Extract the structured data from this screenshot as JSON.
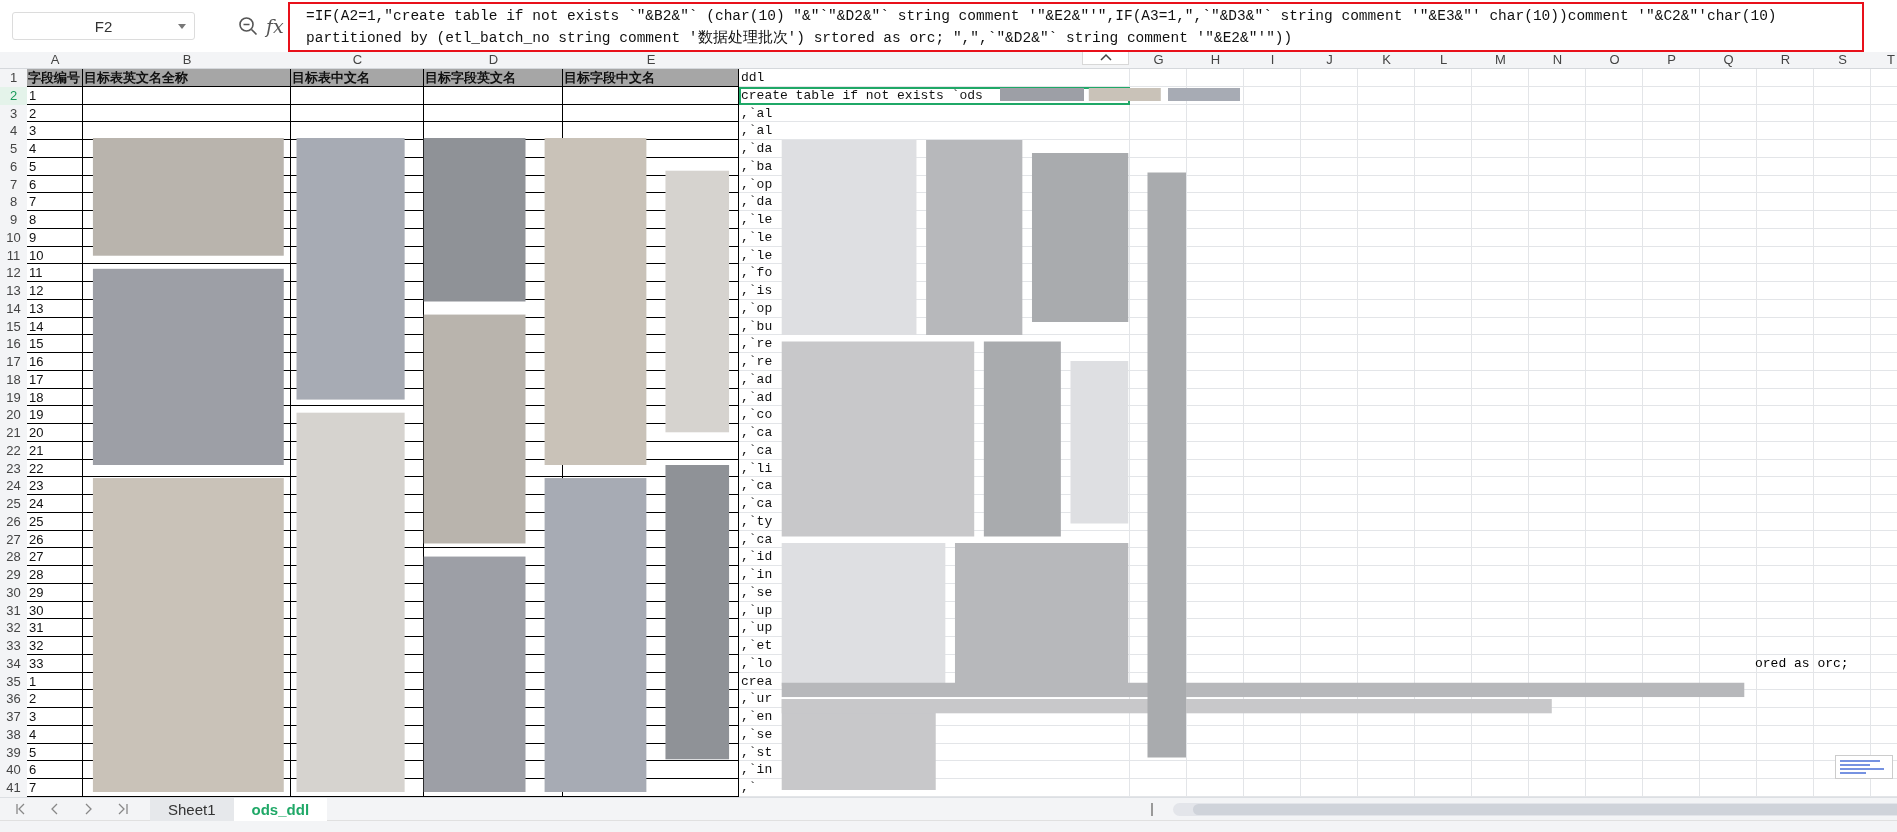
{
  "name_box": {
    "value": "F2"
  },
  "formula_bar": {
    "fx": "fx",
    "lines": [
      "=IF(A2=1,\"create table if not exists `\"&B2&\"` (char(10) \"&\"`\"&D2&\"` string comment '\"&E2&\"'\",IF(A3=1,\",`\"&D3&\"` string comment '\"&E3&\"' char(10))comment '\"&C2&\"'char(10)",
      "partitioned by (etl_batch_no string comment '数据处理批次') srtored as orc; \",\",`\"&D2&\"` string comment '\"&E2&\"'\"))"
    ]
  },
  "columns": [
    {
      "letter": "A"
    },
    {
      "letter": "B"
    },
    {
      "letter": "C"
    },
    {
      "letter": "D"
    },
    {
      "letter": "E"
    },
    {},
    {
      "letter": "G"
    },
    {
      "letter": "H"
    },
    {
      "letter": "I"
    },
    {
      "letter": "J"
    },
    {
      "letter": "K"
    },
    {
      "letter": "L"
    },
    {
      "letter": "M"
    },
    {
      "letter": "N"
    },
    {
      "letter": "O"
    },
    {
      "letter": "P"
    },
    {
      "letter": "Q"
    },
    {
      "letter": "R"
    },
    {
      "letter": "S"
    },
    {
      "letter": "T"
    }
  ],
  "header_row": {
    "num": "1",
    "cells": [
      "字段编号",
      "目标表英文名全称",
      "目标表中文名",
      "目标字段英文名",
      "目标字段中文名",
      "ddl"
    ]
  },
  "rows": [
    {
      "num": "2",
      "a": "1",
      "f": "create table if not exists `ods",
      "selected": true
    },
    {
      "num": "3",
      "a": "2",
      "f": ",`al",
      "selected": false
    },
    {
      "num": "4",
      "a": "3",
      "f": ",`al",
      "selected": false
    },
    {
      "num": "5",
      "a": "4",
      "f": ",`da",
      "selected": false
    },
    {
      "num": "6",
      "a": "5",
      "f": ",`ba",
      "selected": false
    },
    {
      "num": "7",
      "a": "6",
      "f": ",`op",
      "selected": false
    },
    {
      "num": "8",
      "a": "7",
      "f": ",`da",
      "selected": false
    },
    {
      "num": "9",
      "a": "8",
      "f": ",`le",
      "selected": false
    },
    {
      "num": "10",
      "a": "9",
      "f": ",`le",
      "selected": false
    },
    {
      "num": "11",
      "a": "10",
      "f": ",`le",
      "selected": false
    },
    {
      "num": "12",
      "a": "11",
      "f": ",`fo",
      "selected": false
    },
    {
      "num": "13",
      "a": "12",
      "f": ",`is",
      "selected": false
    },
    {
      "num": "14",
      "a": "13",
      "f": ",`op",
      "selected": false
    },
    {
      "num": "15",
      "a": "14",
      "f": ",`bu",
      "selected": false
    },
    {
      "num": "16",
      "a": "15",
      "f": ",`re",
      "selected": false
    },
    {
      "num": "17",
      "a": "16",
      "f": ",`re",
      "selected": false
    },
    {
      "num": "18",
      "a": "17",
      "f": ",`ad",
      "selected": false
    },
    {
      "num": "19",
      "a": "18",
      "f": ",`ad",
      "selected": false
    },
    {
      "num": "20",
      "a": "19",
      "f": ",`co",
      "selected": false
    },
    {
      "num": "21",
      "a": "20",
      "f": ",`ca",
      "selected": false
    },
    {
      "num": "22",
      "a": "21",
      "f": ",`ca",
      "selected": false
    },
    {
      "num": "23",
      "a": "22",
      "f": ",`li",
      "selected": false
    },
    {
      "num": "24",
      "a": "23",
      "f": ",`ca",
      "selected": false
    },
    {
      "num": "25",
      "a": "24",
      "f": ",`ca",
      "selected": false
    },
    {
      "num": "26",
      "a": "25",
      "f": ",`ty",
      "selected": false
    },
    {
      "num": "27",
      "a": "26",
      "f": ",`ca",
      "selected": false
    },
    {
      "num": "28",
      "a": "27",
      "f": ",`id",
      "selected": false
    },
    {
      "num": "29",
      "a": "28",
      "f": ",`in",
      "selected": false
    },
    {
      "num": "30",
      "a": "29",
      "f": ",`se",
      "selected": false
    },
    {
      "num": "31",
      "a": "30",
      "f": ",`up",
      "selected": false
    },
    {
      "num": "32",
      "a": "31",
      "f": ",`up",
      "selected": false
    },
    {
      "num": "33",
      "a": "32",
      "f": ",`et",
      "selected": false
    },
    {
      "num": "34",
      "a": "33",
      "f": ",`lo",
      "suffix": "ored as orc;",
      "selected": false
    },
    {
      "num": "35",
      "a": "1",
      "f": "crea",
      "selected": false
    },
    {
      "num": "36",
      "a": "2",
      "f": ",`ur",
      "selected": false
    },
    {
      "num": "37",
      "a": "3",
      "f": ",`en",
      "selected": false
    },
    {
      "num": "38",
      "a": "4",
      "f": ",`se",
      "selected": false
    },
    {
      "num": "39",
      "a": "5",
      "f": ",`st",
      "selected": false
    },
    {
      "num": "40",
      "a": "6",
      "f": ",`in",
      "selected": false
    },
    {
      "num": "41",
      "a": "7",
      "f": ",`",
      "selected": false
    }
  ],
  "sheet_tabs": [
    {
      "label": "Sheet1",
      "selected": false
    },
    {
      "label": "ods_ddl",
      "selected": true
    }
  ]
}
